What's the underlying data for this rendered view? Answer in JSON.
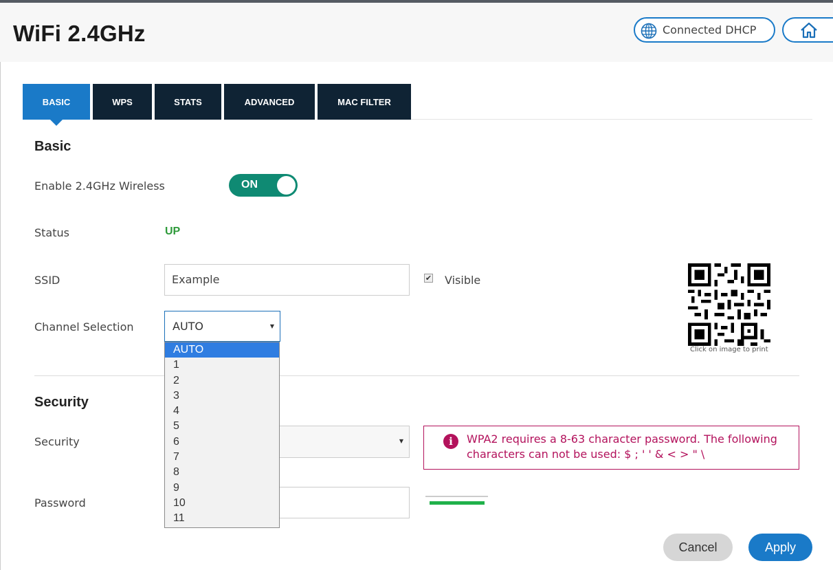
{
  "header": {
    "title": "WiFi 2.4GHz",
    "connection_label": "Connected DHCP",
    "connection_icon": "globe-icon",
    "home_icon": "home-icon"
  },
  "tabs": [
    {
      "label": "BASIC",
      "active": true
    },
    {
      "label": "WPS",
      "active": false
    },
    {
      "label": "STATS",
      "active": false
    },
    {
      "label": "ADVANCED",
      "active": false
    },
    {
      "label": "MAC FILTER",
      "active": false
    }
  ],
  "basic": {
    "heading": "Basic",
    "enable_label": "Enable 2.4GHz Wireless",
    "enable_toggle": "ON",
    "status_label": "Status",
    "status_value": "UP",
    "ssid_label": "SSID",
    "ssid_value": "Example",
    "visible_label": "Visible",
    "visible_checked": true,
    "channel_label": "Channel Selection",
    "channel_value": "AUTO",
    "channel_options": [
      "AUTO",
      "1",
      "2",
      "3",
      "4",
      "5",
      "6",
      "7",
      "8",
      "9",
      "10",
      "11"
    ],
    "qr_caption": "Click on image to print"
  },
  "security": {
    "heading": "Security",
    "security_label": "Security",
    "password_label": "Password",
    "alert_icon": "info-icon",
    "alert_text": "WPA2 requires a 8-63 character password. The following characters can not be used: $ ; ' ' & < > \"  \\"
  },
  "actions": {
    "cancel": "Cancel",
    "apply": "Apply"
  },
  "colors": {
    "accent": "#1a7ac8",
    "tab_dark": "#0f2334",
    "toggle_on": "#0f8a73",
    "status_up": "#2e9a3a",
    "alert": "#b3125c"
  }
}
